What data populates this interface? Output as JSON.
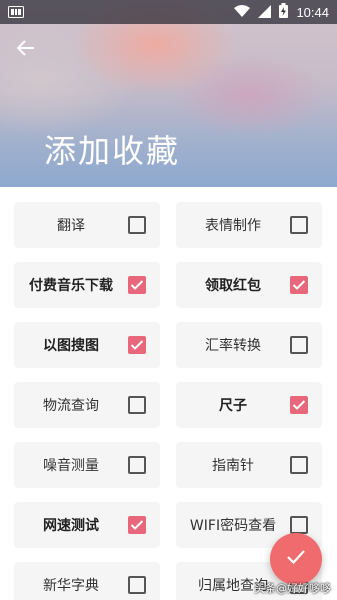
{
  "status_bar": {
    "time": "10:44",
    "icons": [
      "notification-icon",
      "wifi-icon",
      "signal-icon",
      "battery-charging-icon"
    ]
  },
  "header": {
    "title": "添加收藏",
    "back_icon": "arrow-left-icon"
  },
  "items": [
    {
      "label": "翻译",
      "checked": false
    },
    {
      "label": "表情制作",
      "checked": false
    },
    {
      "label": "付费音乐下载",
      "checked": true
    },
    {
      "label": "领取红包",
      "checked": true
    },
    {
      "label": "以图搜图",
      "checked": true
    },
    {
      "label": "汇率转换",
      "checked": false
    },
    {
      "label": "物流查询",
      "checked": false
    },
    {
      "label": "尺子",
      "checked": true
    },
    {
      "label": "噪音测量",
      "checked": false
    },
    {
      "label": "指南针",
      "checked": false
    },
    {
      "label": "网速测试",
      "checked": true
    },
    {
      "label": "WIFI密码查看",
      "checked": false
    },
    {
      "label": "新华字典",
      "checked": false
    },
    {
      "label": "归属地查询",
      "checked": false
    }
  ],
  "fab": {
    "icon": "check-icon"
  },
  "watermark": "头条@好好哆哆",
  "colors": {
    "accent": "#e9677a",
    "fab": "#ef6b6e",
    "card_bg": "#f5f5f5"
  }
}
